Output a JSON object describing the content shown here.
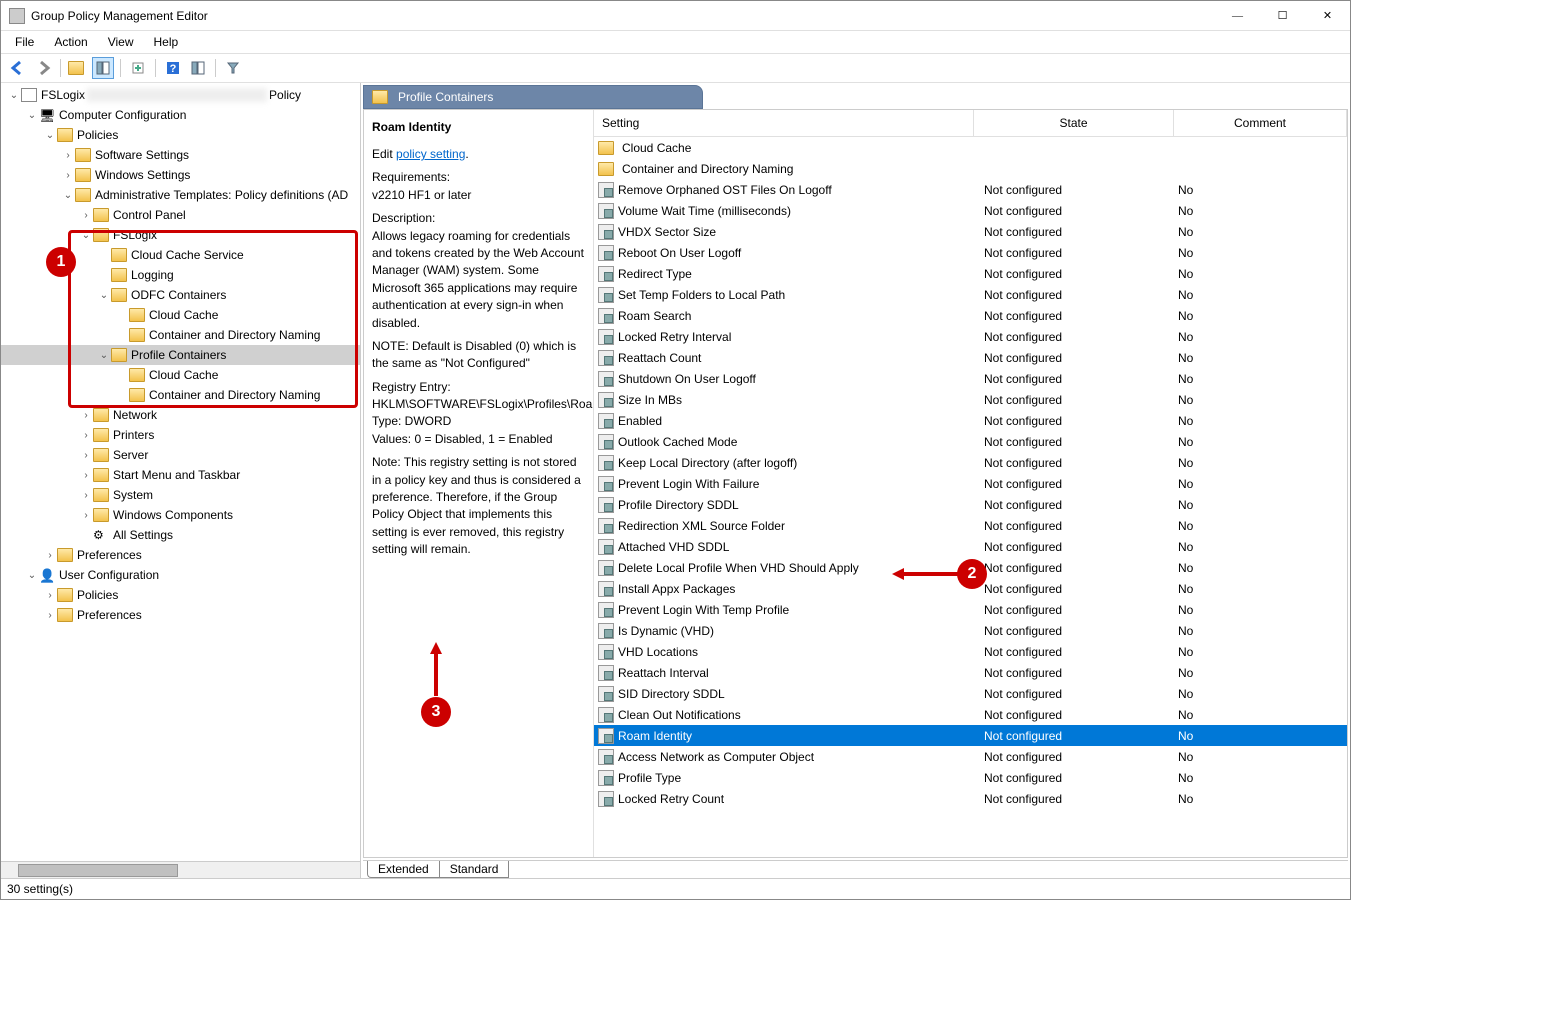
{
  "title": "Group Policy Management Editor",
  "menus": [
    "File",
    "Action",
    "View",
    "Help"
  ],
  "toolbar_labels": [
    "back",
    "forward",
    "up",
    "show-hide-tree",
    "export",
    "properties",
    "help",
    "funnel",
    "filter"
  ],
  "tree": [
    {
      "d": 0,
      "tw": "v",
      "icon": "doc",
      "label": "FSLogix",
      "extra": "Policy",
      "sel": false,
      "root": true
    },
    {
      "d": 1,
      "tw": "v",
      "icon": "comp",
      "label": "Computer Configuration"
    },
    {
      "d": 2,
      "tw": "v",
      "icon": "folder",
      "label": "Policies"
    },
    {
      "d": 3,
      "tw": ">",
      "icon": "folder",
      "label": "Software Settings"
    },
    {
      "d": 3,
      "tw": ">",
      "icon": "folder",
      "label": "Windows Settings"
    },
    {
      "d": 3,
      "tw": "v",
      "icon": "folder",
      "label": "Administrative Templates: Policy definitions (AD"
    },
    {
      "d": 4,
      "tw": ">",
      "icon": "folder",
      "label": "Control Panel"
    },
    {
      "d": 4,
      "tw": "v",
      "icon": "folder",
      "label": "FSLogix"
    },
    {
      "d": 5,
      "tw": " ",
      "icon": "folder",
      "label": "Cloud Cache Service"
    },
    {
      "d": 5,
      "tw": " ",
      "icon": "folder",
      "label": "Logging"
    },
    {
      "d": 5,
      "tw": "v",
      "icon": "folder",
      "label": "ODFC Containers"
    },
    {
      "d": 6,
      "tw": " ",
      "icon": "folder",
      "label": "Cloud Cache"
    },
    {
      "d": 6,
      "tw": " ",
      "icon": "folder",
      "label": "Container and Directory Naming"
    },
    {
      "d": 5,
      "tw": "v",
      "icon": "folder",
      "label": "Profile Containers",
      "sel": true
    },
    {
      "d": 6,
      "tw": " ",
      "icon": "folder",
      "label": "Cloud Cache"
    },
    {
      "d": 6,
      "tw": " ",
      "icon": "folder",
      "label": "Container and Directory Naming"
    },
    {
      "d": 4,
      "tw": ">",
      "icon": "folder",
      "label": "Network"
    },
    {
      "d": 4,
      "tw": ">",
      "icon": "folder",
      "label": "Printers"
    },
    {
      "d": 4,
      "tw": ">",
      "icon": "folder",
      "label": "Server"
    },
    {
      "d": 4,
      "tw": ">",
      "icon": "folder",
      "label": "Start Menu and Taskbar"
    },
    {
      "d": 4,
      "tw": ">",
      "icon": "folder",
      "label": "System"
    },
    {
      "d": 4,
      "tw": ">",
      "icon": "folder",
      "label": "Windows Components"
    },
    {
      "d": 4,
      "tw": " ",
      "icon": "gear",
      "label": "All Settings"
    },
    {
      "d": 2,
      "tw": ">",
      "icon": "folder",
      "label": "Preferences"
    },
    {
      "d": 1,
      "tw": "v",
      "icon": "user",
      "label": "User Configuration"
    },
    {
      "d": 2,
      "tw": ">",
      "icon": "folder",
      "label": "Policies"
    },
    {
      "d": 2,
      "tw": ">",
      "icon": "folder",
      "label": "Preferences"
    }
  ],
  "pane_header": "Profile Containers",
  "desc": {
    "heading": "Roam Identity",
    "edit_prefix": "Edit ",
    "edit_link": "policy setting",
    "req_h": "Requirements:",
    "req_v": "v2210 HF1 or later",
    "desc_h": "Description:",
    "desc_v": "Allows legacy roaming for credentials and tokens created by the Web Account Manager (WAM) system. Some Microsoft 365 applications may require authentication at every sign-in when disabled.",
    "note1": "NOTE:  Default is Disabled (0) which is the same as \"Not Configured\"",
    "reg_h": "Registry Entry:",
    "reg_v1": "HKLM\\SOFTWARE\\FSLogix\\Profiles\\RoamIdentity",
    "reg_v2": "Type: DWORD",
    "reg_v3": "Values:  0 = Disabled, 1 = Enabled",
    "note2": "Note:  This registry setting is not stored in a policy key and thus is considered a preference.  Therefore, if the Group Policy Object that implements this setting is ever removed, this registry setting will remain."
  },
  "cols": {
    "setting": "Setting",
    "state": "State",
    "comment": "Comment"
  },
  "settings": [
    {
      "type": "folder",
      "label": "Cloud Cache"
    },
    {
      "type": "folder",
      "label": "Container and Directory Naming"
    },
    {
      "type": "item",
      "label": "Remove Orphaned OST Files On Logoff",
      "state": "Not configured",
      "comment": "No"
    },
    {
      "type": "item",
      "label": "Volume Wait Time (milliseconds)",
      "state": "Not configured",
      "comment": "No"
    },
    {
      "type": "item",
      "label": "VHDX Sector Size",
      "state": "Not configured",
      "comment": "No"
    },
    {
      "type": "item",
      "label": "Reboot On User Logoff",
      "state": "Not configured",
      "comment": "No"
    },
    {
      "type": "item",
      "label": "Redirect Type",
      "state": "Not configured",
      "comment": "No"
    },
    {
      "type": "item",
      "label": "Set Temp Folders to Local Path",
      "state": "Not configured",
      "comment": "No"
    },
    {
      "type": "item",
      "label": "Roam Search",
      "state": "Not configured",
      "comment": "No"
    },
    {
      "type": "item",
      "label": "Locked Retry Interval",
      "state": "Not configured",
      "comment": "No"
    },
    {
      "type": "item",
      "label": "Reattach Count",
      "state": "Not configured",
      "comment": "No"
    },
    {
      "type": "item",
      "label": "Shutdown On User Logoff",
      "state": "Not configured",
      "comment": "No"
    },
    {
      "type": "item",
      "label": "Size In MBs",
      "state": "Not configured",
      "comment": "No"
    },
    {
      "type": "item",
      "label": "Enabled",
      "state": "Not configured",
      "comment": "No"
    },
    {
      "type": "item",
      "label": "Outlook Cached Mode",
      "state": "Not configured",
      "comment": "No"
    },
    {
      "type": "item",
      "label": "Keep Local Directory (after logoff)",
      "state": "Not configured",
      "comment": "No"
    },
    {
      "type": "item",
      "label": "Prevent Login With Failure",
      "state": "Not configured",
      "comment": "No"
    },
    {
      "type": "item",
      "label": "Profile Directory SDDL",
      "state": "Not configured",
      "comment": "No"
    },
    {
      "type": "item",
      "label": "Redirection XML Source Folder",
      "state": "Not configured",
      "comment": "No"
    },
    {
      "type": "item",
      "label": "Attached VHD SDDL",
      "state": "Not configured",
      "comment": "No"
    },
    {
      "type": "item",
      "label": "Delete Local Profile When VHD Should Apply",
      "state": "Not configured",
      "comment": "No"
    },
    {
      "type": "item",
      "label": "Install Appx Packages",
      "state": "Not configured",
      "comment": "No"
    },
    {
      "type": "item",
      "label": "Prevent Login With Temp Profile",
      "state": "Not configured",
      "comment": "No"
    },
    {
      "type": "item",
      "label": "Is Dynamic (VHD)",
      "state": "Not configured",
      "comment": "No"
    },
    {
      "type": "item",
      "label": "VHD Locations",
      "state": "Not configured",
      "comment": "No"
    },
    {
      "type": "item",
      "label": "Reattach Interval",
      "state": "Not configured",
      "comment": "No"
    },
    {
      "type": "item",
      "label": "SID Directory SDDL",
      "state": "Not configured",
      "comment": "No"
    },
    {
      "type": "item",
      "label": "Clean Out Notifications",
      "state": "Not configured",
      "comment": "No"
    },
    {
      "type": "item",
      "label": "Roam Identity",
      "state": "Not configured",
      "comment": "No",
      "sel": true
    },
    {
      "type": "item",
      "label": "Access Network as Computer Object",
      "state": "Not configured",
      "comment": "No"
    },
    {
      "type": "item",
      "label": "Profile Type",
      "state": "Not configured",
      "comment": "No"
    },
    {
      "type": "item",
      "label": "Locked Retry Count",
      "state": "Not configured",
      "comment": "No"
    }
  ],
  "tabs": [
    "Extended",
    "Standard"
  ],
  "status": "30 setting(s)",
  "annotations": {
    "1": "1",
    "2": "2",
    "3": "3"
  }
}
